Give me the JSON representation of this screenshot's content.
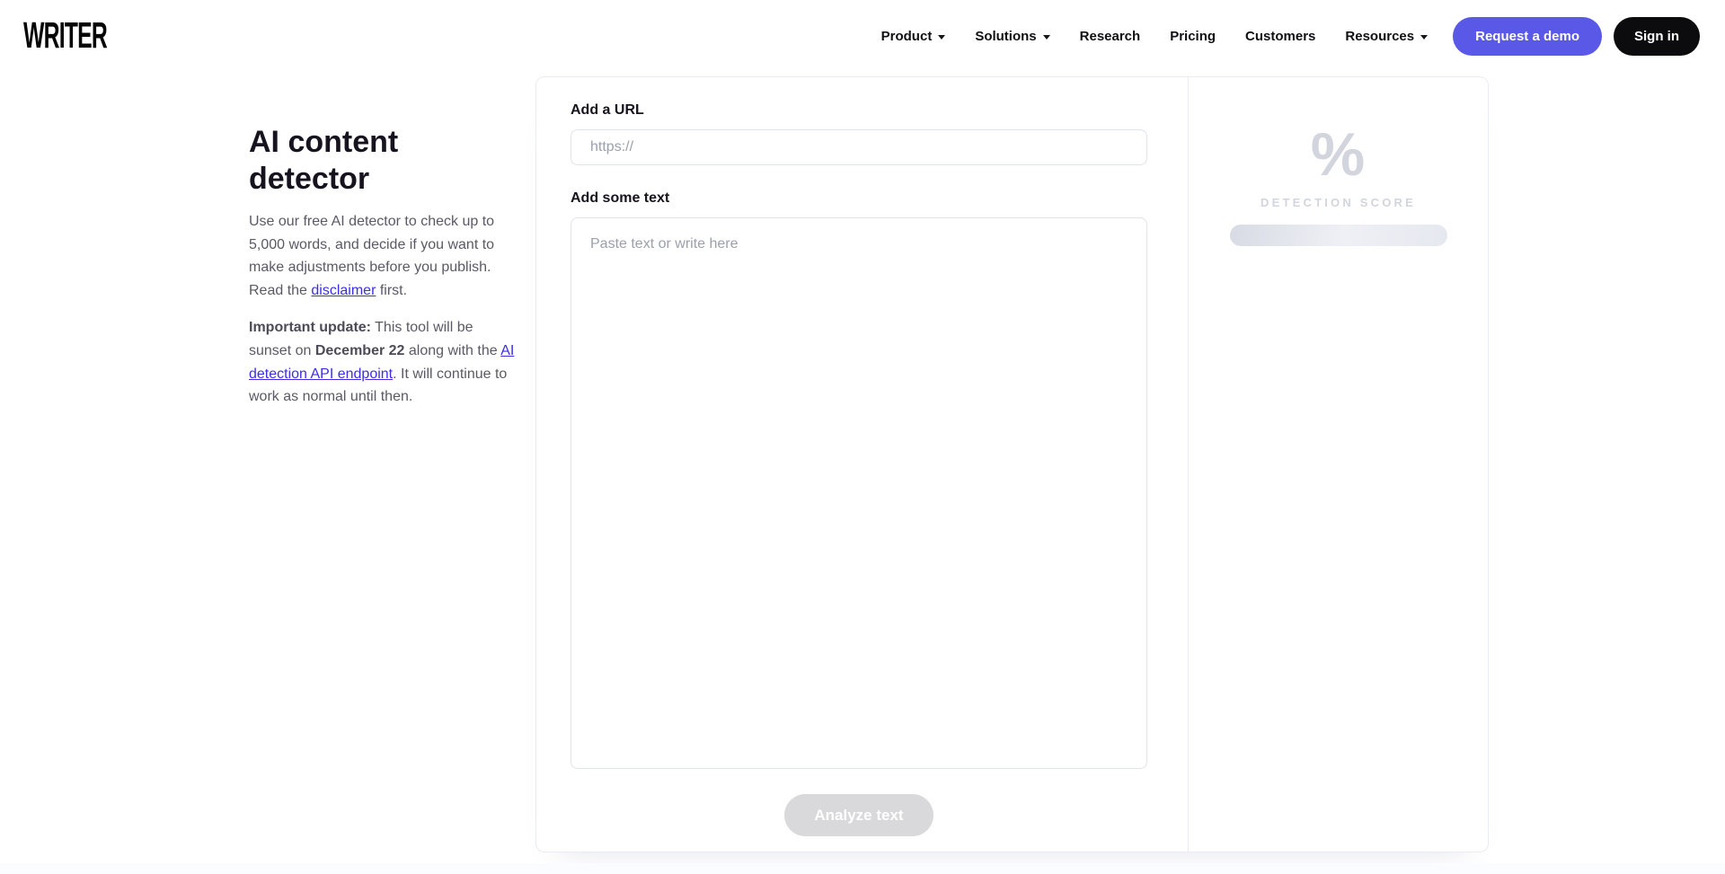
{
  "brand": {
    "logo_text": "WRITER"
  },
  "nav": {
    "items": [
      {
        "label": "Product",
        "has_dropdown": true
      },
      {
        "label": "Solutions",
        "has_dropdown": true
      },
      {
        "label": "Research",
        "has_dropdown": false
      },
      {
        "label": "Pricing",
        "has_dropdown": false
      },
      {
        "label": "Customers",
        "has_dropdown": false
      },
      {
        "label": "Resources",
        "has_dropdown": true
      }
    ],
    "request_demo_label": "Request a demo",
    "sign_in_label": "Sign in"
  },
  "intro": {
    "title": "AI content detector",
    "desc_before_link": "Use our free AI detector to check up to 5,000 words, and decide if you want to make adjustments before you publish. Read the ",
    "disclaimer_link": "disclaimer",
    "desc_after_link": " first.",
    "update_bold_1": "Important update:",
    "update_text_1": " This tool will be sunset on ",
    "update_bold_2": "December 22",
    "update_text_2": " along with the ",
    "update_link": "AI detection API endpoint",
    "update_text_3": ". It will continue to work as normal until then."
  },
  "form": {
    "url_label": "Add a URL",
    "url_placeholder": "https://",
    "url_value": "",
    "text_label": "Add some text",
    "text_placeholder": "Paste text or write here",
    "text_value": "",
    "analyze_button_label": "Analyze text",
    "analyze_button_enabled": false
  },
  "score_panel": {
    "percent_symbol": "%",
    "label": "DETECTION SCORE"
  },
  "colors": {
    "accent_purple": "#5a58e6",
    "sign_in_black": "#0c0c0e",
    "link_blue": "#3b2ee4",
    "disabled_button_gray": "#d9d9dc",
    "score_muted_gray": "#d3d5de",
    "card_border": "#e9ecf4"
  }
}
